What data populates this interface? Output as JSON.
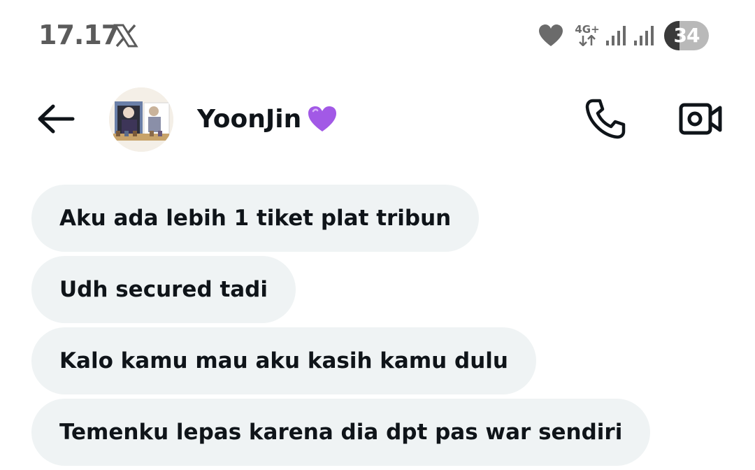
{
  "status_bar": {
    "time": "17.17",
    "network_label": "4G+",
    "battery_level": "34",
    "icons": [
      "x-logo-icon",
      "heart-icon",
      "network-arrows-icon",
      "signal-icon",
      "signal-icon",
      "battery-icon"
    ]
  },
  "header": {
    "back_icon": "arrow-left-icon",
    "contact_name": "YoonJin",
    "name_emoji": "purple-heart-icon",
    "call_icon": "phone-icon",
    "video_icon": "video-camera-icon"
  },
  "messages": [
    {
      "text": "Aku ada lebih 1 tiket plat tribun"
    },
    {
      "text": "Udh secured tadi"
    },
    {
      "text": "Kalo kamu mau aku kasih kamu dulu"
    },
    {
      "text": "Temenku lepas karena dia dpt pas war sendiri"
    }
  ],
  "colors": {
    "bubble_bg": "#eff3f4",
    "text": "#0f1419",
    "status_gray": "#5b5b5b",
    "emoji_purple": "#a259e6"
  }
}
